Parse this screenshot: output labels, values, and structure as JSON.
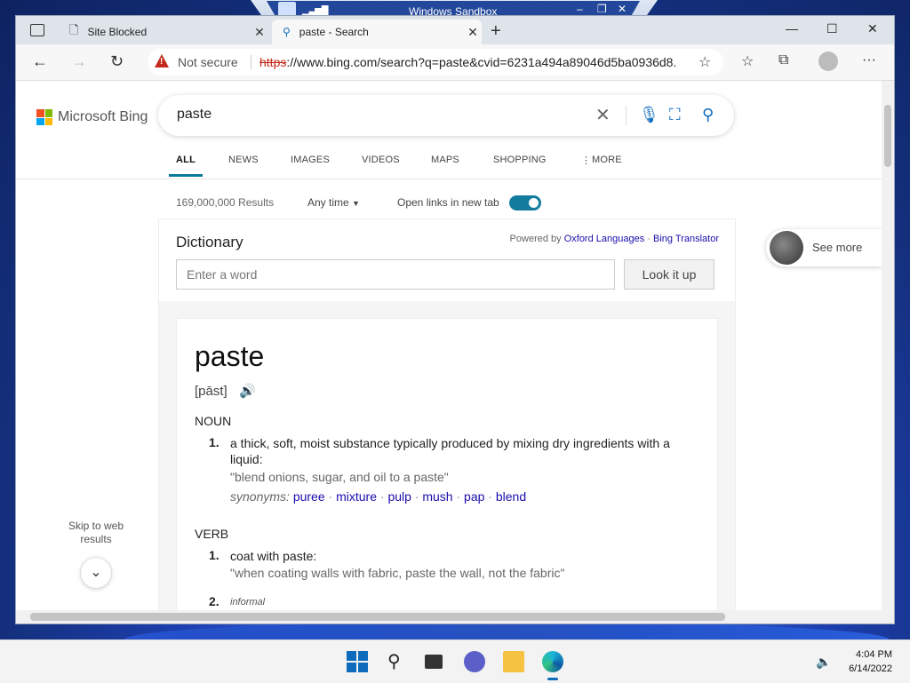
{
  "sandbox": {
    "title": "Windows Sandbox"
  },
  "browser": {
    "tabs": [
      {
        "label": "Site Blocked",
        "active": false
      },
      {
        "label": "paste - Search",
        "active": true
      }
    ],
    "address": {
      "security_label": "Not secure",
      "scheme": "https",
      "rest": "://www.bing.com/search?q=paste&cvid=6231a494a89046d5ba0936d8..."
    }
  },
  "bing": {
    "logo_text": "Microsoft Bing",
    "query": "paste",
    "nav": [
      "ALL",
      "NEWS",
      "IMAGES",
      "VIDEOS",
      "MAPS",
      "SHOPPING",
      "MORE"
    ],
    "results_count": "169,000,000 Results",
    "time_filter": "Any time",
    "open_links_label": "Open links in new tab",
    "open_links_on": true,
    "see_more": "See more",
    "skip_label": "Skip to web results"
  },
  "dictionary": {
    "title": "Dictionary",
    "powered_prefix": "Powered by",
    "provider1": "Oxford Languages",
    "separator": "·",
    "provider2": "Bing Translator",
    "input_placeholder": "Enter a word",
    "lookup_button": "Look it up",
    "word": "paste",
    "pronunciation": "[pāst]",
    "noun_label": "NOUN",
    "noun_def_num": "1.",
    "noun_def": "a thick, soft, moist substance typically produced by mixing dry ingredients with a liquid:",
    "noun_example": "\"blend onions, sugar, and oil to a paste\"",
    "synonyms_label": "synonyms:",
    "synonyms": [
      "puree",
      "mixture",
      "pulp",
      "mush",
      "pap",
      "blend"
    ],
    "verb_label": "VERB",
    "verb_def1_num": "1.",
    "verb_def1": "coat with paste:",
    "verb_example1": "\"when coating walls with fabric, paste the wall, not the fabric\"",
    "verb_def2_num": "2.",
    "verb_def2_tag": "informal"
  },
  "taskbar": {
    "time": "4:04 PM",
    "date": "6/14/2022"
  }
}
